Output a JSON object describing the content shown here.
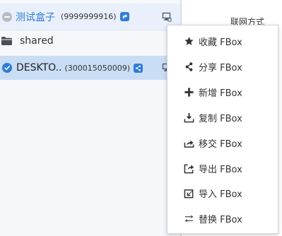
{
  "tree": {
    "box": {
      "name": "测试盒子",
      "id": "(9999999916)",
      "status_icon": "minus-circle-icon",
      "share_icon": "share-badge-icon",
      "action_icon": "device-action-icon"
    },
    "shared": {
      "label": "shared",
      "icon": "folder-icon"
    },
    "device": {
      "name": "DESKTO..",
      "id": "(300015050009)",
      "status_icon": "check-circle-icon",
      "share_icon": "share-badge-icon",
      "action_icon": "device-action-icon"
    }
  },
  "right_panel": {
    "title": "联网方式"
  },
  "context_menu": {
    "items": [
      {
        "icon": "star-icon",
        "label": "收藏 FBox"
      },
      {
        "icon": "share-icon",
        "label": "分享 FBox"
      },
      {
        "icon": "plus-icon",
        "label": "新增 FBox"
      },
      {
        "icon": "download-icon",
        "label": "复制 FBox"
      },
      {
        "icon": "transfer-icon",
        "label": "移交 FBox"
      },
      {
        "icon": "export-icon",
        "label": "导出 FBox"
      },
      {
        "icon": "import-icon",
        "label": "导入 FBox"
      },
      {
        "icon": "swap-icon",
        "label": "替换 FBox"
      }
    ]
  },
  "colors": {
    "accent": "#2f7bd9",
    "selected_row": "#c9ddf5",
    "hover_row": "#e9f0fb",
    "icon_dark": "#333333"
  }
}
